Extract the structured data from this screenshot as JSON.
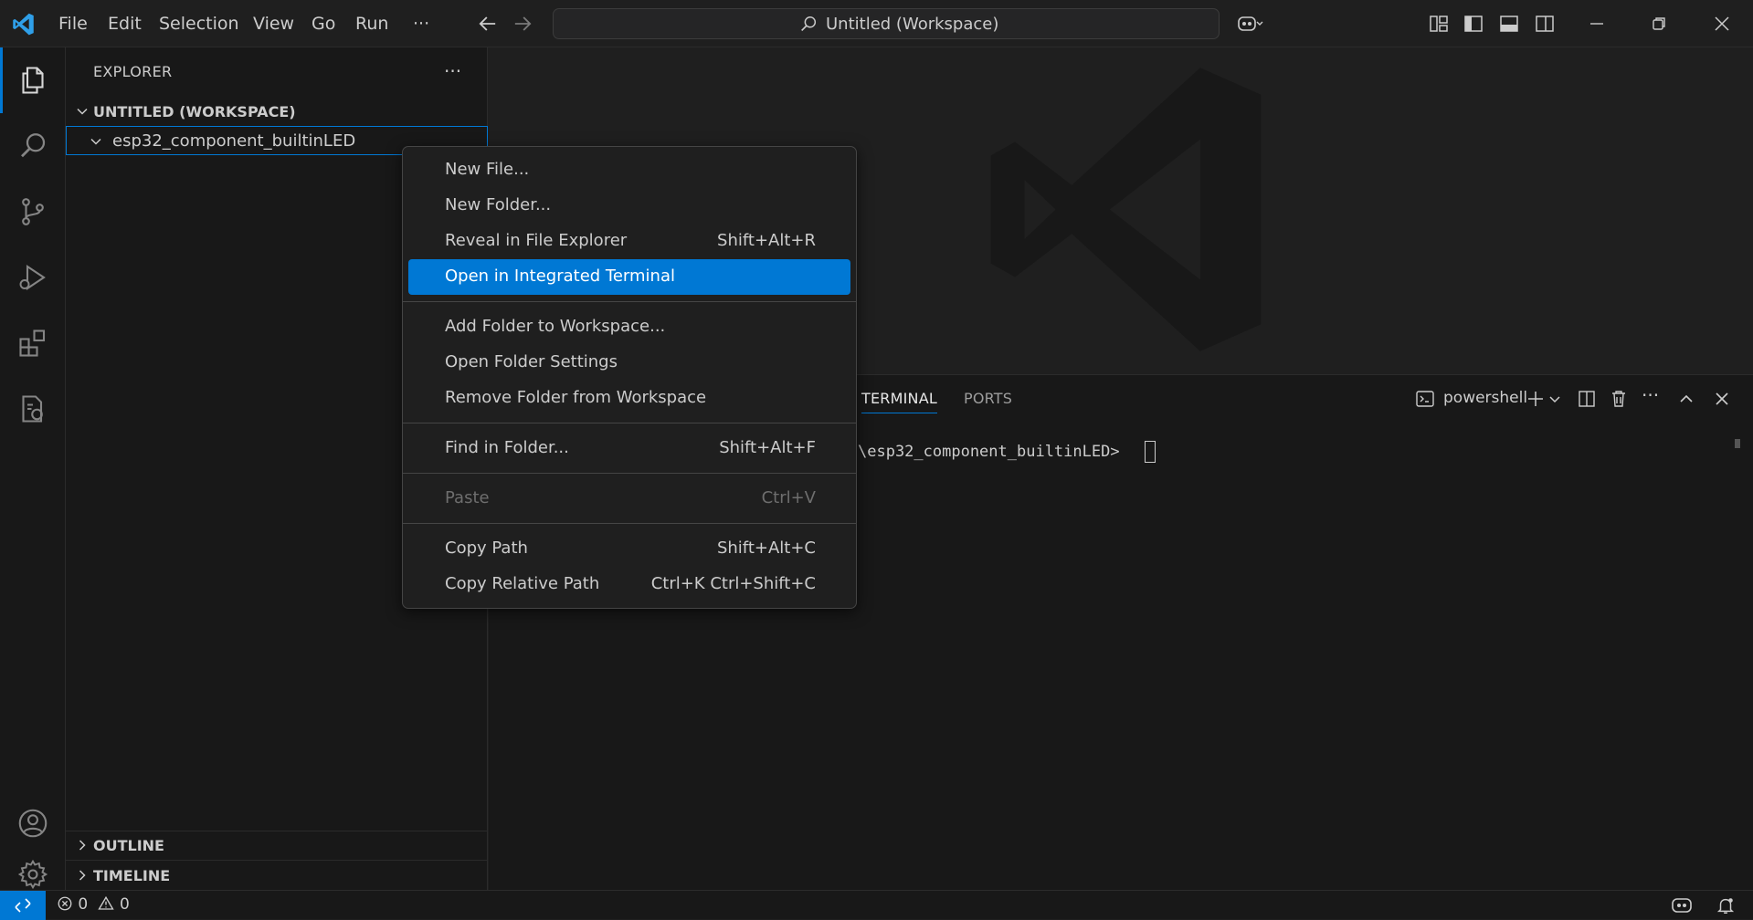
{
  "titlebar": {
    "menus": [
      "File",
      "Edit",
      "Selection",
      "View",
      "Go",
      "Run",
      "···"
    ],
    "search_text": "Untitled (Workspace)"
  },
  "sidebar": {
    "title": "EXPLORER",
    "more": "···",
    "workspace_label": "UNTITLED (WORKSPACE)",
    "folder_label": "esp32_component_builtinLED",
    "outline_label": "OUTLINE",
    "timeline_label": "TIMELINE"
  },
  "context_menu": {
    "items": [
      {
        "label": "New File...",
        "shortcut": ""
      },
      {
        "label": "New Folder...",
        "shortcut": ""
      },
      {
        "label": "Reveal in File Explorer",
        "shortcut": "Shift+Alt+R"
      },
      {
        "label": "Open in Integrated Terminal",
        "shortcut": ""
      },
      {
        "label": "Add Folder to Workspace...",
        "shortcut": ""
      },
      {
        "label": "Open Folder Settings",
        "shortcut": ""
      },
      {
        "label": "Remove Folder from Workspace",
        "shortcut": ""
      },
      {
        "label": "Find in Folder...",
        "shortcut": "Shift+Alt+F"
      },
      {
        "label": "Paste",
        "shortcut": "Ctrl+V"
      },
      {
        "label": "Copy Path",
        "shortcut": "Shift+Alt+C"
      },
      {
        "label": "Copy Relative Path",
        "shortcut": "Ctrl+K Ctrl+Shift+C"
      }
    ],
    "selected_index": 3,
    "disabled_index": 8
  },
  "panel": {
    "tabs": [
      "TERMINAL",
      "PORTS"
    ],
    "active_tab": "TERMINAL",
    "terminal_profile": "powershell",
    "terminal_line": "\\esp32_component_builtinLED>"
  },
  "statusbar": {
    "errors": "0",
    "warnings": "0"
  },
  "colors": {
    "accent": "#0078d4",
    "background": "#1f1f1f",
    "sidebar_bg": "#181818"
  }
}
